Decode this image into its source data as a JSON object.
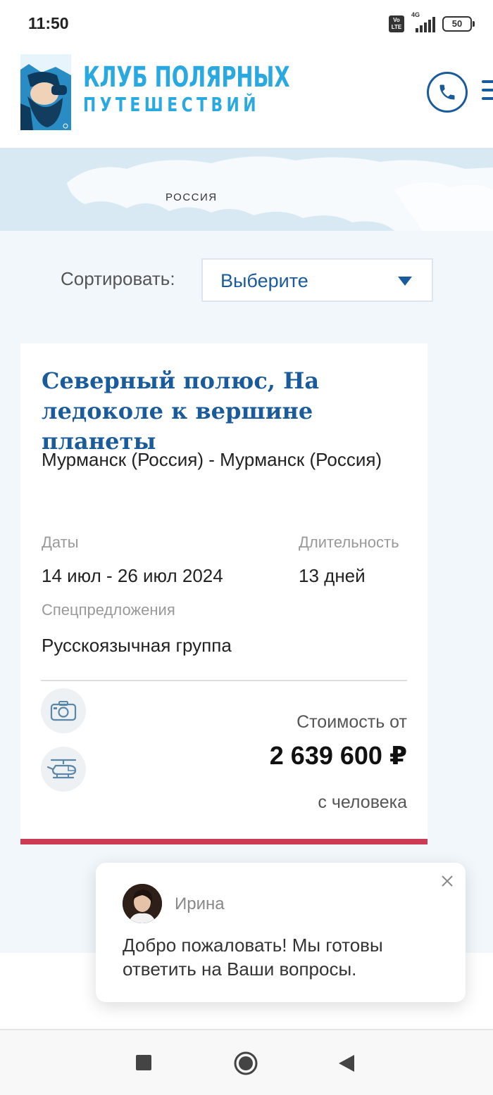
{
  "status_bar": {
    "time": "11:50",
    "network": "4G",
    "volte": "Vo LTE",
    "battery": "50"
  },
  "header": {
    "logo_line1": "КЛУБ ПОЛЯРНЫХ",
    "logo_line2": "ПУТЕШЕСТВИЙ",
    "phone_icon": "phone-icon",
    "menu_icon": "hamburger-menu-icon",
    "brand_color": "#29a9e0",
    "accent_color": "#1a5b9c"
  },
  "banner": {
    "label": "РОССИЯ"
  },
  "sort": {
    "label": "Сортировать:",
    "value": "Выберите"
  },
  "tour_card": {
    "title": "Северный полюс, На ледоколе к вершине планеты",
    "route": "Мурманск (Россия) - Мурманск (Россия)",
    "dates_label": "Даты",
    "dates_value": "14 июл - 26 июл 2024",
    "duration_label": "Длительность",
    "duration_value": "13 дней",
    "offers_label": "Спецпредложения",
    "offers_value": "Русскоязычная группа",
    "features": [
      "camera-icon",
      "helicopter-icon"
    ],
    "price_label": "Стоимость от",
    "price_value": "2 639 600 ₽",
    "price_unit": "с человека",
    "accent_color": "#cc3b53"
  },
  "chat": {
    "agent_name": "Ирина",
    "message": "Добро пожаловать! Мы готовы ответить на Ваши вопросы."
  },
  "nav": {
    "buttons": [
      "recent-apps-icon",
      "home-icon",
      "back-icon"
    ]
  }
}
